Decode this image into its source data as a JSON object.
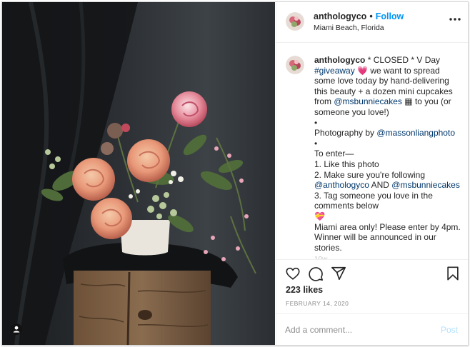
{
  "post": {
    "username": "anthologyco",
    "follow_label": "Follow",
    "location": "Miami Beach, Florida",
    "dot": "•"
  },
  "caption": {
    "username": "anthologyco",
    "line_intro": "* CLOSED * V Day",
    "hashtag": "#giveaway",
    "heart_emoji": "💗",
    "line_body": "we want to spread some love today by hand-delivering this beauty + a dozen mini cupcakes from",
    "mention_bunnie": "@msbunniecakes",
    "cupcake_glyph": "▦",
    "line_body2": "to you (or someone you love!)",
    "bullet": "•",
    "photo_label": "Photography by",
    "mention_photo": "@massonliangphoto",
    "enter_label": "To enter—",
    "step1": "1. Like this photo",
    "step2_prefix": "2. Make sure you're following",
    "mention_antho": "@anthologyco",
    "and_label": "AND",
    "mention_bunnie2": "@msbunniecakes",
    "step3": "3. Tag someone you love in the comments below",
    "ribbon_emoji": "💝",
    "closing": "Miami area only! Please enter by 4pm. Winner will be announced in our stories.",
    "cut_off": "10w"
  },
  "actions": {
    "likes": "223 likes",
    "date": "FEBRUARY 14, 2020"
  },
  "comment": {
    "placeholder": "Add a comment...",
    "post_label": "Post"
  },
  "icons": {
    "more": "more-horizontal-icon",
    "like": "heart-outline-icon",
    "comment": "comment-bubble-icon",
    "share": "paper-plane-icon",
    "save": "bookmark-icon",
    "user_tag": "user-tag-icon"
  },
  "colors": {
    "link": "#00376b",
    "follow": "#0095f6",
    "muted": "#8e8e8e",
    "post_disabled": "#b2dffc"
  }
}
